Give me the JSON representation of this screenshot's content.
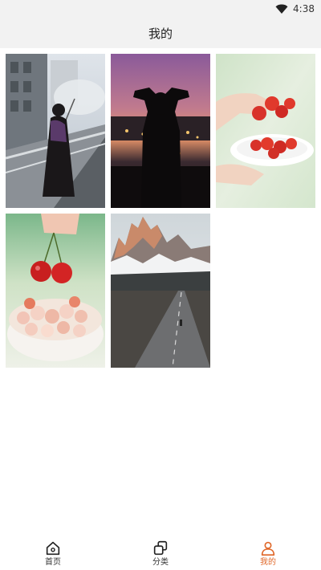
{
  "status_bar": {
    "time": "4:38",
    "wifi_icon": "wifi-icon"
  },
  "app_bar": {
    "title": "我的"
  },
  "gallery": {
    "photos": [
      {
        "name": "photo-woman-umbrella"
      },
      {
        "name": "photo-sunset-silhouette"
      },
      {
        "name": "photo-hands-tomatoes"
      },
      {
        "name": "photo-cherries-bowl"
      },
      {
        "name": "photo-mountain-road"
      }
    ]
  },
  "tabbar": {
    "accent_color": "#e0682a",
    "items": [
      {
        "label": "首页",
        "icon": "home-icon",
        "active": false
      },
      {
        "label": "分类",
        "icon": "category-icon",
        "active": false
      },
      {
        "label": "我的",
        "icon": "user-icon",
        "active": true
      }
    ]
  }
}
